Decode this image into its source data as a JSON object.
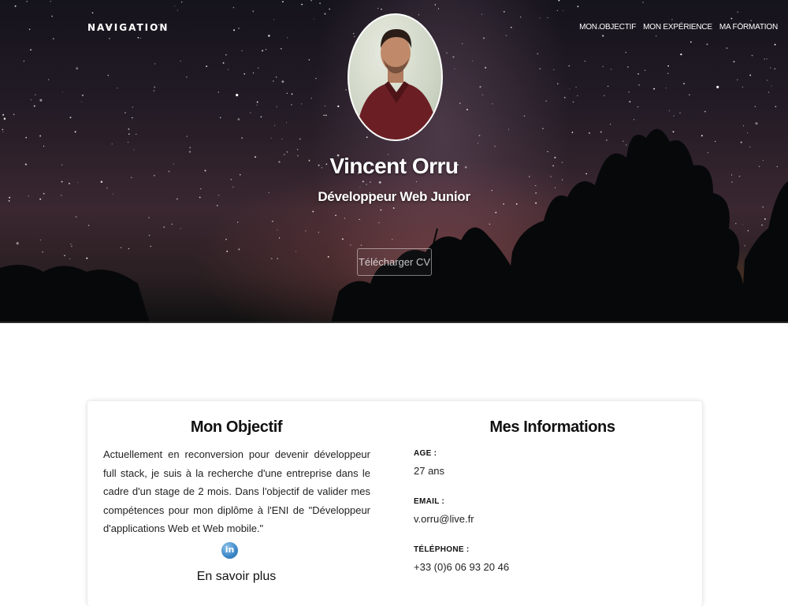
{
  "nav": {
    "brand": "NAVIGATION",
    "links": [
      "MON OBJECTIF",
      "MON EXPÉRIENCE",
      "MA FORMATION"
    ]
  },
  "hero": {
    "name": "Vincent Orru",
    "subtitle": "Développeur Web Junior",
    "cv_button": "Télécharger CV"
  },
  "objectif": {
    "title": "Mon Objectif",
    "text": "Actuellement en reconversion pour devenir développeur full stack, je suis à la recherche d'une entreprise dans le cadre d'un stage de 2 mois. Dans l'objectif de valider mes compétences pour mon diplôme à l'ENI de \"Développeur d'applications Web et Web mobile.\"",
    "linkedin_icon_text": "in",
    "more_link": "En savoir plus"
  },
  "infos": {
    "title": "Mes Informations",
    "items": [
      {
        "label": "AGE :",
        "value": "27 ans"
      },
      {
        "label": "EMAIL :",
        "value": "v.orru@live.fr"
      },
      {
        "label": "TÉLÉPHONE :",
        "value": "+33 (0)6 06 93 20 46"
      }
    ]
  },
  "colors": {
    "hero_text": "#ffffff",
    "linkedin": "#3b86c6",
    "card_bg": "#ffffff"
  },
  "icons": [
    "linkedin-icon"
  ]
}
